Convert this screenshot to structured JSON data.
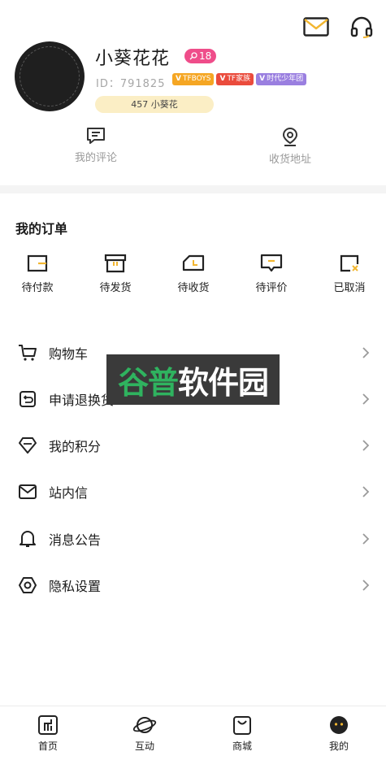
{
  "header": {
    "icons": [
      "mail-icon",
      "headset-icon"
    ]
  },
  "profile": {
    "username": "小葵花花",
    "level": "18",
    "uid": "ID：791825",
    "tags": [
      "TFBOYS",
      "TF家族",
      "时代少年团"
    ],
    "fans_label": "457 小葵花"
  },
  "quick_links": [
    {
      "label": "我的评论",
      "icon": "comment-icon"
    },
    {
      "label": "收货地址",
      "icon": "location-icon"
    }
  ],
  "orders": {
    "title": "我的订单",
    "items": [
      {
        "label": "待付款",
        "icon": "wallet-icon"
      },
      {
        "label": "待发货",
        "icon": "box-icon"
      },
      {
        "label": "待收货",
        "icon": "truck-icon"
      },
      {
        "label": "待评价",
        "icon": "review-icon"
      },
      {
        "label": "已取消",
        "icon": "cancel-icon"
      }
    ]
  },
  "menu": [
    {
      "label": "购物车",
      "icon": "cart-icon"
    },
    {
      "label": "申请退换货",
      "icon": "return-icon"
    },
    {
      "label": "我的积分",
      "icon": "diamond-icon"
    },
    {
      "label": "站内信",
      "icon": "envelope-icon"
    },
    {
      "label": "消息公告",
      "icon": "bell-icon"
    },
    {
      "label": "隐私设置",
      "icon": "settings-icon"
    }
  ],
  "watermark": {
    "green": "谷普",
    "white": "软件园"
  },
  "bottom_nav": [
    {
      "label": "首页",
      "icon": "home-icon"
    },
    {
      "label": "互动",
      "icon": "planet-icon"
    },
    {
      "label": "商城",
      "icon": "shopping-bag-icon"
    },
    {
      "label": "我的",
      "icon": "me-icon"
    }
  ],
  "colors": {
    "level_badge": "#ef4d8a",
    "tag_tfboys": "#f5a623",
    "tag_family": "#ea4b3c",
    "tag_team": "#9a7fe0",
    "fans_bg": "#fbeec5",
    "watermark_green": "#2fb35f"
  }
}
